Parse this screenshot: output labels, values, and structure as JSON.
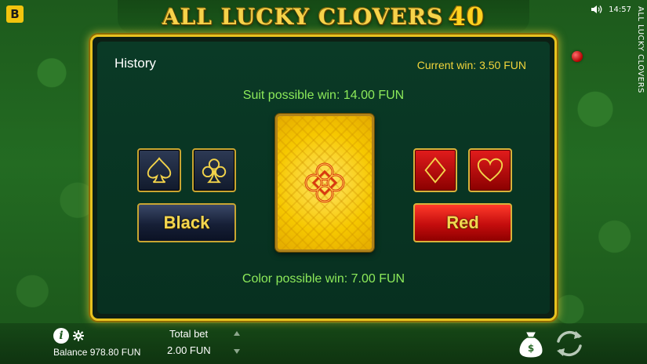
{
  "game": {
    "title_text": "ALL LUCKY CLOVERS",
    "title_number": "40",
    "side_title": "ALL LUCKY CLOVERS",
    "brand_letter": "B"
  },
  "status_bar": {
    "time": "14:57"
  },
  "gamble": {
    "history_label": "History",
    "current_win": "Current win: 3.50 FUN",
    "suit_possible_win": "Suit possible win: 14.00 FUN",
    "color_possible_win": "Color possible win: 7.00 FUN",
    "black_label": "Black",
    "red_label": "Red",
    "suits": {
      "spade": "spade-icon",
      "club": "club-icon",
      "diamond": "diamond-icon",
      "heart": "heart-icon"
    }
  },
  "footer": {
    "balance": "Balance 978.80 FUN",
    "total_bet_label": "Total bet",
    "total_bet_value": "2.00 FUN"
  },
  "colors": {
    "accent_gold": "#e8c21f",
    "win_green": "#8dea5a",
    "current_win_yellow": "#f2d53c",
    "red_button": "#c40d0d",
    "black_button": "#161f36"
  }
}
